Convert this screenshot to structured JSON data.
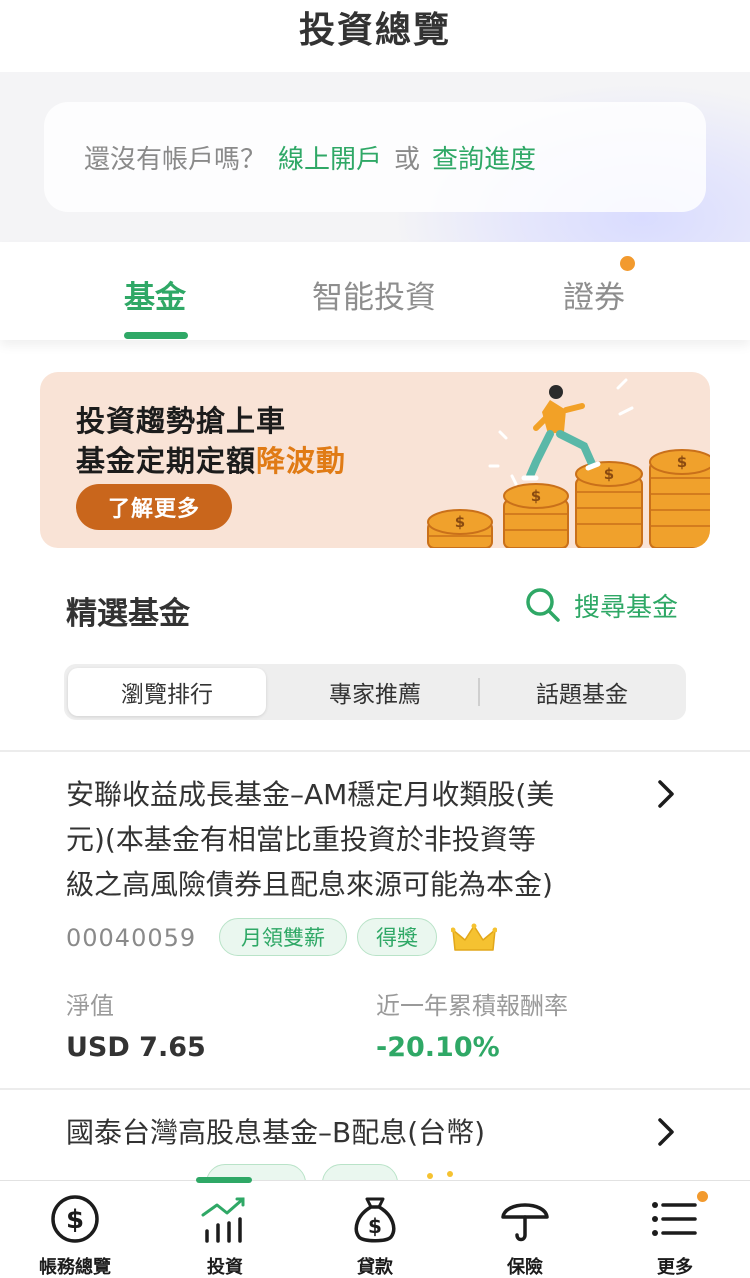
{
  "header": {
    "title": "投資總覽"
  },
  "account_prompt": {
    "question": "還沒有帳戶嗎？",
    "open_link": "線上開戶",
    "or_text": "或",
    "progress_link": "查詢進度"
  },
  "tabs": [
    {
      "label": "基金",
      "active": true
    },
    {
      "label": "智能投資",
      "active": false
    },
    {
      "label": "證券",
      "active": false,
      "has_notification": true
    }
  ],
  "banner": {
    "line1": "投資趨勢搶上車",
    "line2_prefix": "基金定期定額",
    "line2_highlight": "降波動",
    "cta": "了解更多"
  },
  "featured": {
    "title": "精選基金",
    "search_label": "搜尋基金",
    "segments": [
      {
        "label": "瀏覽排行",
        "active": true
      },
      {
        "label": "專家推薦",
        "active": false
      },
      {
        "label": "話題基金",
        "active": false
      }
    ]
  },
  "funds": [
    {
      "name_lines": [
        "安聯收益成長基金–AM穩定月收類股(美",
        "元)(本基金有相當比重投資於非投資等",
        "級之高風險債券且配息來源可能為本金)"
      ],
      "code": "00040059",
      "tags": [
        "月領雙薪",
        "得獎"
      ],
      "crown_icon": "crown-icon",
      "nav_label": "淨值",
      "nav_value": "USD 7.65",
      "return_label": "近一年累積報酬率",
      "return_value": "-20.10%"
    },
    {
      "name_lines": [
        "國泰台灣高股息基金–B配息(台幣)"
      ],
      "crown_icon": "crown-icon"
    }
  ],
  "bottom_nav": [
    {
      "label": "帳務總覽",
      "icon": "dollar-circle-icon",
      "active": false
    },
    {
      "label": "投資",
      "icon": "chart-bars-icon",
      "active": true
    },
    {
      "label": "貸款",
      "icon": "money-bag-icon",
      "active": false
    },
    {
      "label": "保險",
      "icon": "umbrella-icon",
      "active": false
    },
    {
      "label": "更多",
      "icon": "menu-list-icon",
      "active": false,
      "has_notification": true
    }
  ],
  "colors": {
    "brand_green": "#2fa866",
    "notification_orange": "#f29a2e",
    "banner_bg": "#f9e3d6",
    "banner_cta": "#c9661c",
    "highlight_orange": "#e07b15"
  }
}
